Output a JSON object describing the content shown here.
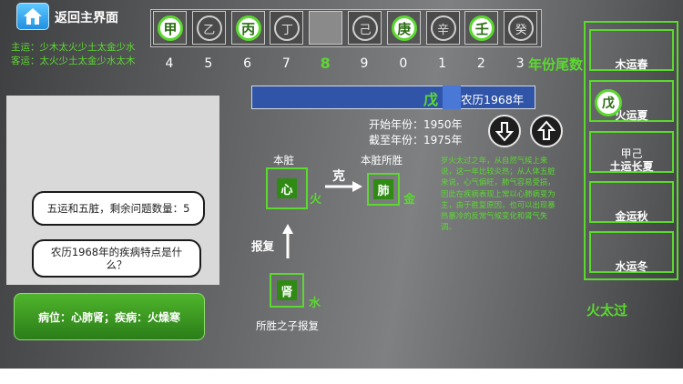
{
  "header": {
    "home_label": "返回主界面",
    "zhu_yun": "主运：少木太火少土太金少水",
    "ke_yun": "客运：太火少土太金少水太木"
  },
  "stems": [
    {
      "label": "甲",
      "active": true
    },
    {
      "label": "乙",
      "active": false
    },
    {
      "label": "丙",
      "active": true
    },
    {
      "label": "丁",
      "active": false
    },
    {
      "label": "",
      "active": false
    },
    {
      "label": "己",
      "active": false
    },
    {
      "label": "庚",
      "active": true
    },
    {
      "label": "辛",
      "active": false
    },
    {
      "label": "壬",
      "active": true
    },
    {
      "label": "癸",
      "active": false
    }
  ],
  "digits": [
    "4",
    "5",
    "6",
    "7",
    "8",
    "9",
    "0",
    "1",
    "2",
    "3"
  ],
  "digits_selected_index": 4,
  "digits_label": "年份尾数",
  "chat": {
    "q1": "五运和五脏，剩余问题数量：5",
    "q2": "农历1968年的疾病特点是什么？",
    "diagnosis": "病位：心肺肾；疾病：火燥寒"
  },
  "year": {
    "stem": "戊",
    "lunar": "农历1968年",
    "start_label": "开始年份：1950年",
    "end_label": "截至年份：1975年"
  },
  "organs": {
    "self_label": "本脏",
    "self_organ": "心",
    "self_elem": "火",
    "overcome_label": "克",
    "target_label": "本脏所胜",
    "target_organ": "肺",
    "target_elem": "金",
    "revenge_label": "报复",
    "child_organ": "肾",
    "child_elem": "水",
    "child_label": "所胜之子报复"
  },
  "description": "岁火太过之年，从自然气候上来说，这一年比较炎热；从人体五脏来说，心气偏旺，肺气容易受损，因此在疾病表现上常以心肺病变为主，由于胜复原因，也可以出现暴热暴冷的反常气候变化和肾气失调。",
  "seasons": [
    {
      "label": "木运春",
      "extra": "",
      "circle": ""
    },
    {
      "label": "火运夏",
      "extra": "",
      "circle": "戊"
    },
    {
      "label": "土运长夏",
      "extra": "甲己",
      "circle": ""
    },
    {
      "label": "金运秋",
      "extra": "",
      "circle": ""
    },
    {
      "label": "水运冬",
      "extra": "",
      "circle": ""
    }
  ],
  "result": "火太过",
  "colors": {
    "accent": "#5bd92f",
    "year_bar": "#2f54a8",
    "diagnosis_bg": "#3c9a22"
  }
}
